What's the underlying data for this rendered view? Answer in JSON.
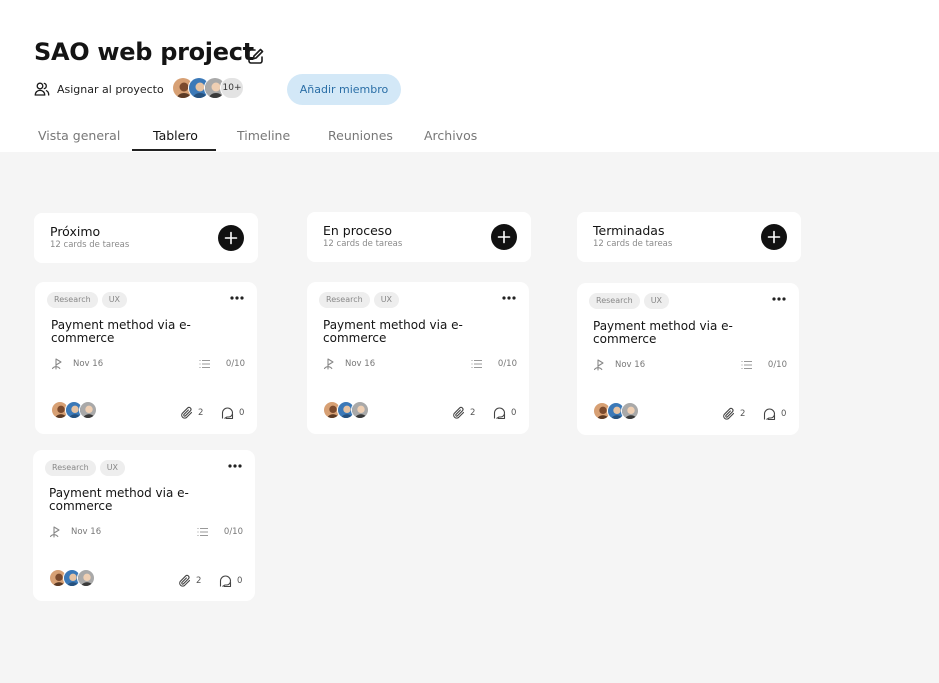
{
  "project": {
    "title": "SAO web project",
    "assign_label": "Asignar al proyecto",
    "more_members": "10+",
    "add_member_label": "Añadir miembro"
  },
  "tabs": [
    {
      "label": "Vista general",
      "active": false
    },
    {
      "label": "Tablero",
      "active": true
    },
    {
      "label": "Timeline",
      "active": false
    },
    {
      "label": "Reuniones",
      "active": false
    },
    {
      "label": "Archivos",
      "active": false
    }
  ],
  "columns": [
    {
      "title": "Próximo",
      "subtitle": "12 cards de tareas"
    },
    {
      "title": "En proceso",
      "subtitle": "12 cards de tareas"
    },
    {
      "title": "Terminadas",
      "subtitle": "12 cards de tareas"
    }
  ],
  "cards": [
    {
      "tags": [
        "Research",
        "UX"
      ],
      "title": "Payment method via e-commerce",
      "date": "Nov 16",
      "progress": "0/10",
      "attachments": "2",
      "comments": "0"
    },
    {
      "tags": [
        "Research",
        "UX"
      ],
      "title": "Payment method via e-commerce",
      "date": "Nov 16",
      "progress": "0/10",
      "attachments": "2",
      "comments": "0"
    },
    {
      "tags": [
        "Research",
        "UX"
      ],
      "title": "Payment method via e-commerce",
      "date": "Nov 16",
      "progress": "0/10",
      "attachments": "2",
      "comments": "0"
    },
    {
      "tags": [
        "Research",
        "UX"
      ],
      "title": "Payment method via e-commerce",
      "date": "Nov 16",
      "progress": "0/10",
      "attachments": "2",
      "comments": "0"
    }
  ],
  "icons": {
    "edit": "edit-icon",
    "assign": "user-group-icon",
    "add": "plus-icon",
    "more": "more-dots-icon",
    "date": "flag-icon",
    "checklist": "checklist-icon",
    "attachment": "paperclip-icon",
    "comment": "comment-icon"
  },
  "colors": {
    "board_bg": "#f5f5f5",
    "add_member_bg": "#d3e8f7",
    "add_member_text": "#2a6ea6",
    "column_add_button": "#111111"
  }
}
